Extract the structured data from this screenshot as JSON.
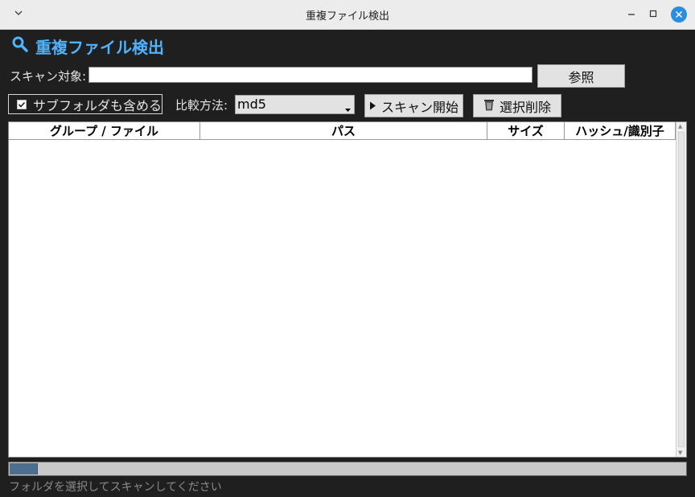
{
  "window": {
    "title": "重複ファイル検出"
  },
  "header": {
    "title": "重複ファイル検出",
    "icon": "magnifier-icon",
    "color": "#4fb3ff"
  },
  "scan": {
    "label": "スキャン対象:",
    "value": "",
    "browse_label": "参照"
  },
  "options": {
    "include_subfolders_label": "サブフォルダも含める",
    "include_subfolders_checked": true,
    "method_label": "比較方法:",
    "method_value": "md5",
    "start_label": "スキャン開始",
    "delete_label": "選択削除"
  },
  "table": {
    "columns": [
      "グループ / ファイル",
      "パス",
      "サイズ",
      "ハッシュ/識別子"
    ],
    "rows": []
  },
  "progress": {
    "value": 0.04
  },
  "status": {
    "text": "フォルダを選択してスキャンしてください"
  }
}
